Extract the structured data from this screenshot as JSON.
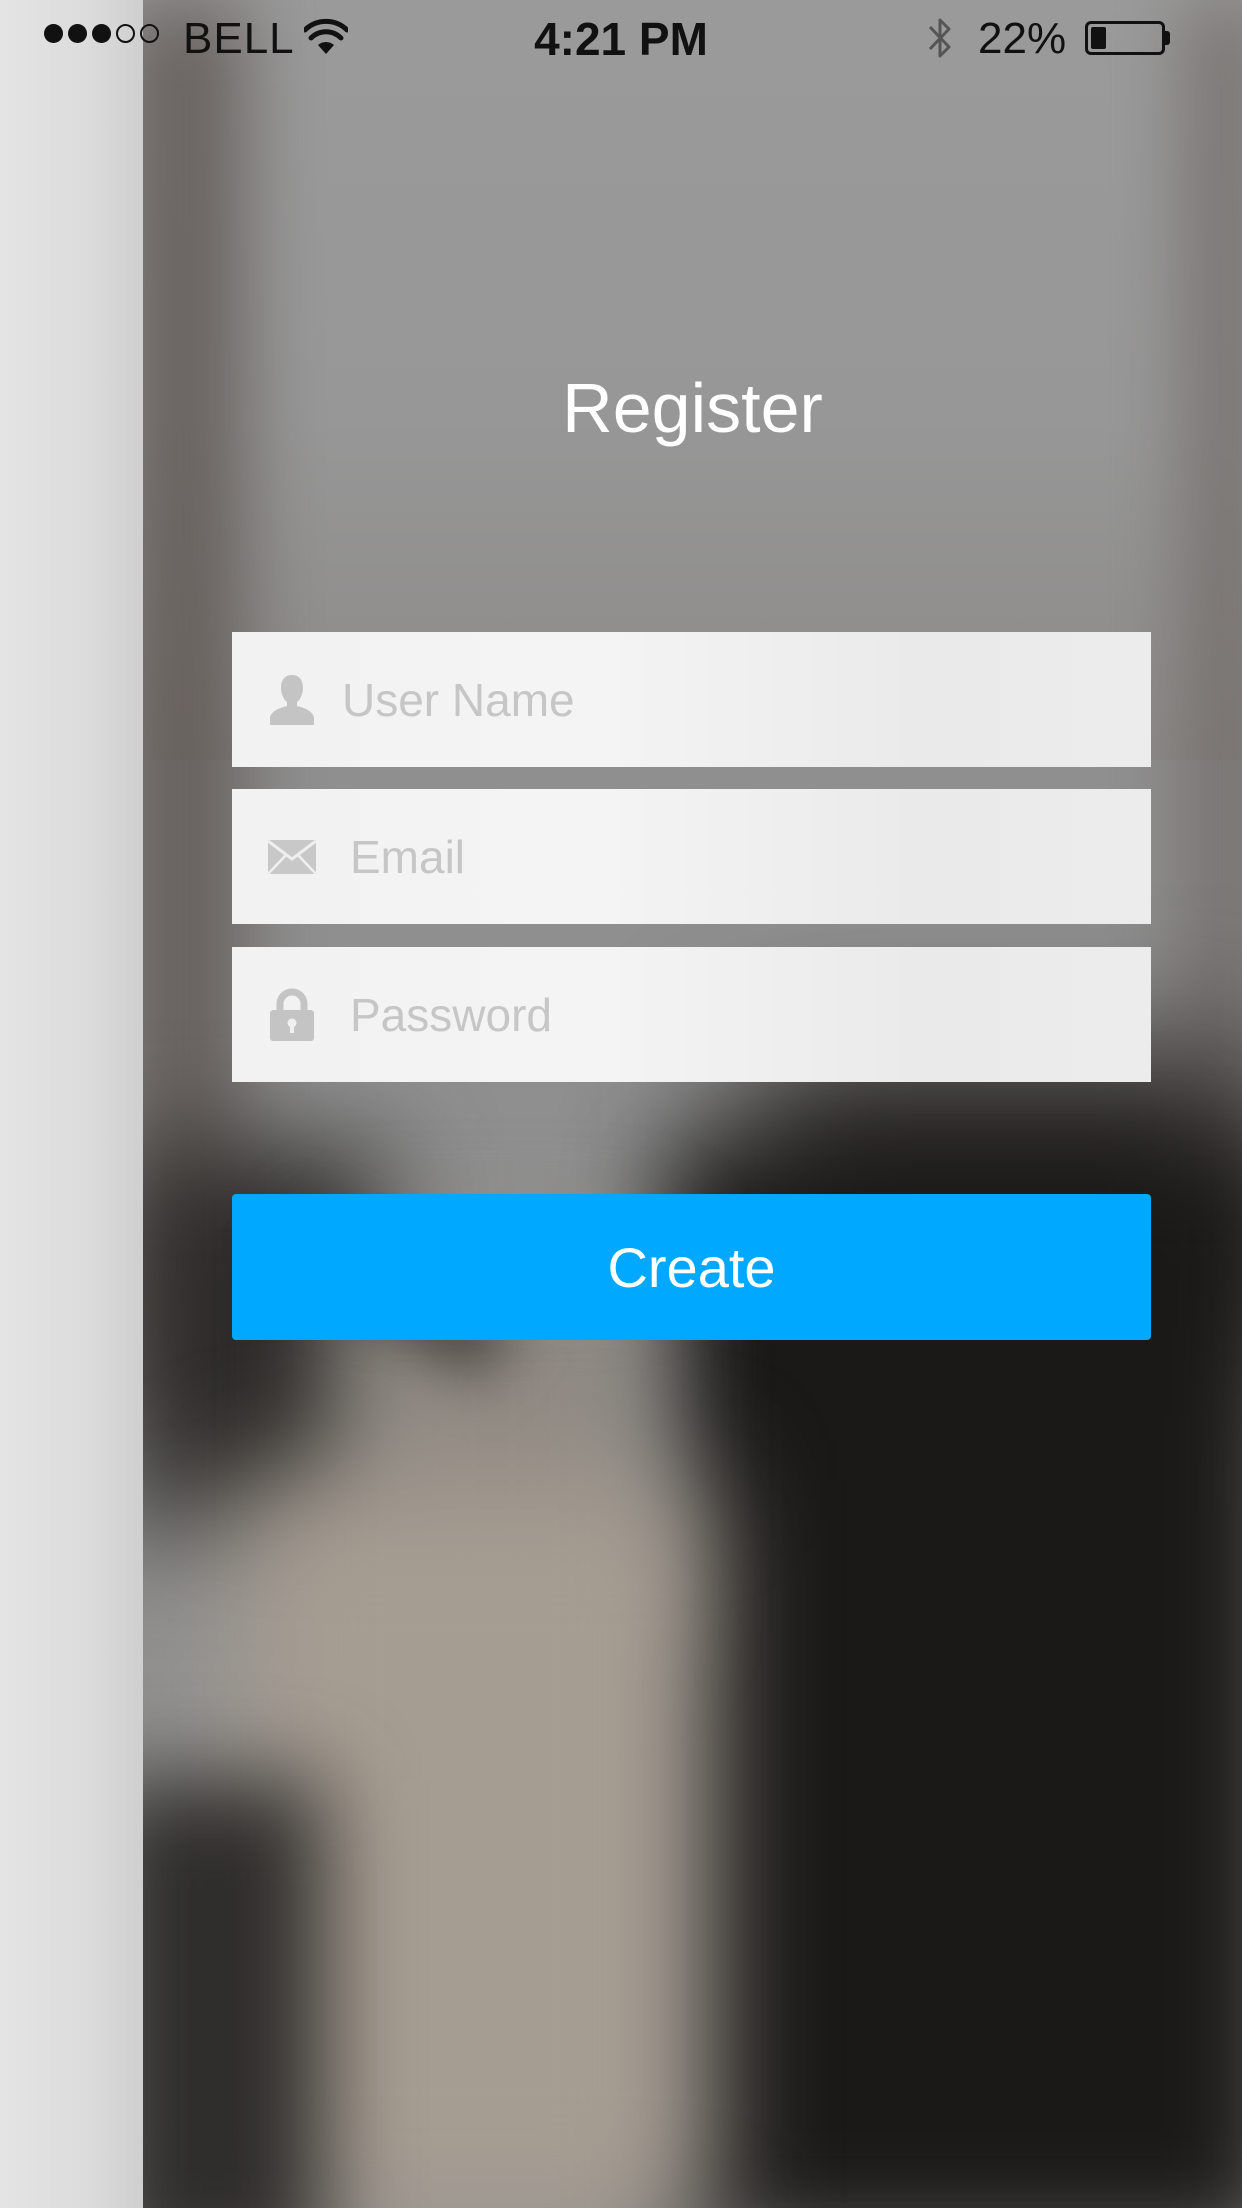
{
  "status_bar": {
    "carrier": "BELL",
    "signal_bars_filled": 3,
    "signal_bars_total": 5,
    "time": "4:21 PM",
    "battery_percent": "22%",
    "battery_level": 0.22,
    "icons": [
      "wifi-icon",
      "bluetooth-icon",
      "battery-icon"
    ]
  },
  "header": {
    "title": "Register"
  },
  "form": {
    "username": {
      "placeholder": "User Name",
      "value": "",
      "icon": "user-icon"
    },
    "email": {
      "placeholder": "Email",
      "value": "",
      "icon": "envelope-icon"
    },
    "password": {
      "placeholder": "Password",
      "value": "",
      "icon": "lock-icon"
    }
  },
  "actions": {
    "create_label": "Create"
  },
  "colors": {
    "accent": "#00a8ff",
    "field_bg": "#f2f2f2",
    "placeholder": "#c6c6c6",
    "title": "#ffffff"
  }
}
